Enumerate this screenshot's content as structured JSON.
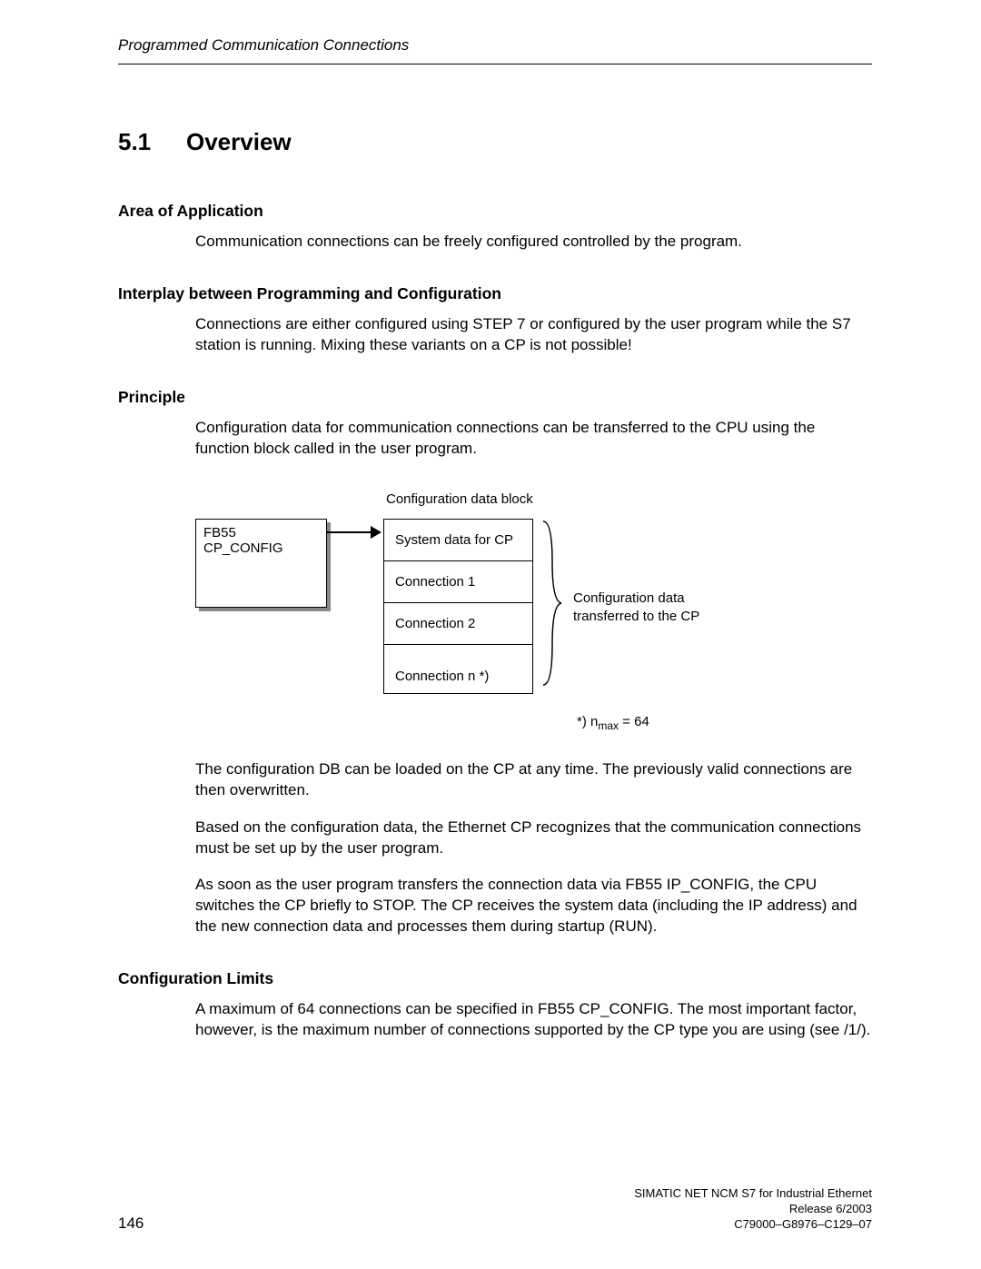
{
  "header": {
    "running_title": "Programmed Communication Connections"
  },
  "section": {
    "number": "5.1",
    "title": "Overview"
  },
  "area_of_application": {
    "heading": "Area of Application",
    "body": "Communication connections can be freely configured controlled by the program."
  },
  "interplay": {
    "heading": "Interplay between Programming and Configuration",
    "body": "Connections are either configured using STEP 7 or configured by the user program while the S7 station is running. Mixing these variants on a CP is not possible!"
  },
  "principle": {
    "heading": "Principle",
    "intro": "Configuration data for communication connections can be transferred to the CPU using the function block called in the user program.",
    "diagram": {
      "fb_box": "FB55 CP_CONFIG",
      "cdb_label": "Configuration data block",
      "cdb_rows": {
        "r1": "System data for CP",
        "r2": "Connection 1",
        "r3": "Connection 2",
        "r4": "Connection n *)"
      },
      "brace_text_l1": "Configuration data",
      "brace_text_l2": "transferred to the CP",
      "nmax_prefix": "*) n",
      "nmax_sub": "max",
      "nmax_suffix": " = 64"
    },
    "p1": "The configuration DB can be loaded on the CP at any time. The previously valid connections are then overwritten.",
    "p2": "Based on the configuration data, the Ethernet CP recognizes that the communication connections must be set up by the user program.",
    "p3": "As soon as the user program transfers the connection data via FB55 IP_CONFIG, the CPU switches the CP briefly to STOP. The CP receives the system data (including the IP address) and the new connection data and processes them during startup (RUN)."
  },
  "config_limits": {
    "heading": "Configuration Limits",
    "body": "A maximum of 64 connections can be specified in FB55 CP_CONFIG. The most important factor, however, is the maximum number of connections supported by the CP type you are using (see /1/)."
  },
  "footer": {
    "page_number": "146",
    "doc_line1": "SIMATIC NET NCM S7 for Industrial Ethernet",
    "doc_line2": "Release 6/2003",
    "doc_line3": "C79000–G8976–C129–07"
  }
}
